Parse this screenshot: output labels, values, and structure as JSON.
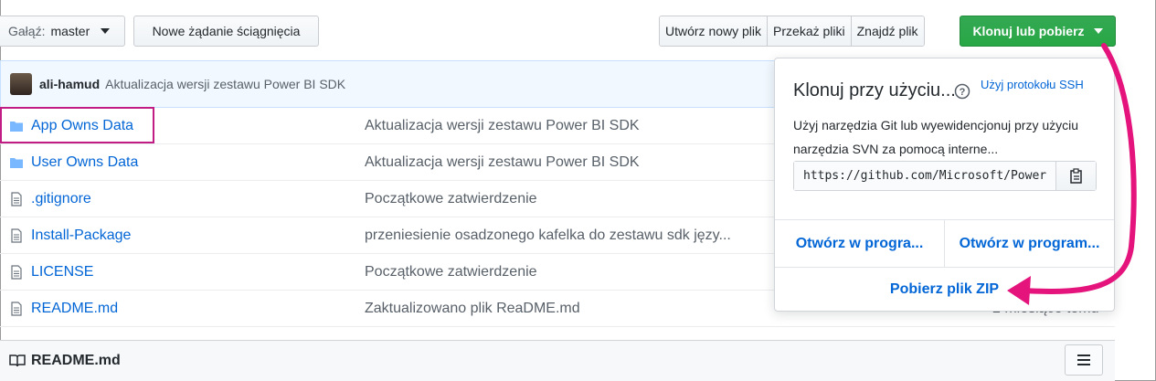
{
  "toolbar": {
    "branch_label": "Gałąź:",
    "branch_value": "master",
    "new_pr_label": "Nowe żądanie ściągnięcia",
    "create_file_label": "Utwórz nowy plik",
    "upload_label": "Przekaż pliki",
    "find_label": "Znajdź plik",
    "clone_label": "Klonuj lub pobierz"
  },
  "commit": {
    "author": "ali-hamud",
    "message": "Aktualizacja wersji zestawu Power BI SDK"
  },
  "files": [
    {
      "name": "App Owns Data",
      "type": "folder",
      "message": "Aktualizacja wersji zestawu Power BI SDK"
    },
    {
      "name": "User Owns Data",
      "type": "folder",
      "message": "Aktualizacja wersji zestawu Power BI SDK"
    },
    {
      "name": ".gitignore",
      "type": "file",
      "message": "Początkowe zatwierdzenie"
    },
    {
      "name": "Install-Package",
      "type": "file",
      "message": "przeniesienie osadzonego kafelka do zestawu sdk języ..."
    },
    {
      "name": "LICENSE",
      "type": "file",
      "message": "Początkowe zatwierdzenie"
    },
    {
      "name": "README.md",
      "type": "file",
      "message": "Zaktualizowano plik ReaDME.md",
      "age": "2 miesiące temu"
    }
  ],
  "readme": {
    "title": "README.md"
  },
  "clone_popup": {
    "title": "Klonuj przy użyciu...",
    "ssh_link": "Użyj protokołu SSH",
    "description": "Użyj narzędzia Git lub wyewidencjonuj przy użyciu narzędzia SVN za pomocą interne...",
    "url": "https://github.com/Microsoft/PowerBI-Developer-Samples.git",
    "open_desktop_1": "Otwórz w progra...",
    "open_desktop_2": "Otwórz w program...",
    "download_zip": "Pobierz plik ZIP"
  },
  "colors": {
    "highlight": "#c11c84",
    "clone_button": "#28a745",
    "link": "#0366d6"
  },
  "icons": [
    "caret-down-icon",
    "folder-icon",
    "file-icon",
    "help-icon",
    "clipboard-icon",
    "book-icon",
    "menu-icon"
  ]
}
